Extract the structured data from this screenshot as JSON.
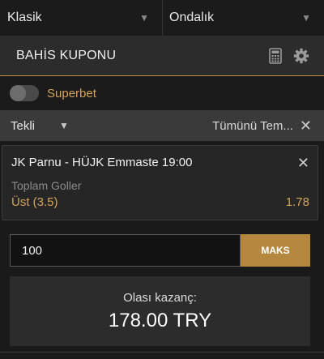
{
  "topbar": {
    "odds_format_selected": "Klasik",
    "odds_type_selected": "Ondalık"
  },
  "coupon": {
    "title": "BAHİS KUPONU",
    "icons": [
      "calculator-icon",
      "gear-icon"
    ]
  },
  "superbet": {
    "label": "Superbet",
    "enabled": false
  },
  "bet_type": {
    "selected": "Tekli",
    "clear_all_label": "Tümünü Tem..."
  },
  "bets": [
    {
      "match": "JK Parnu - HÜJK Emmaste 19:00",
      "market": "Toplam Goller",
      "selection": "Üst (3.5)",
      "odds": "1.78"
    }
  ],
  "stake": {
    "value": "100",
    "max_label": "MAKS"
  },
  "potential_win": {
    "label": "Olası kazanç:",
    "value": "178.00 TRY"
  },
  "colors": {
    "accent": "#b6883f",
    "gold_text": "#d4a45a",
    "background": "#1a1a1a"
  }
}
